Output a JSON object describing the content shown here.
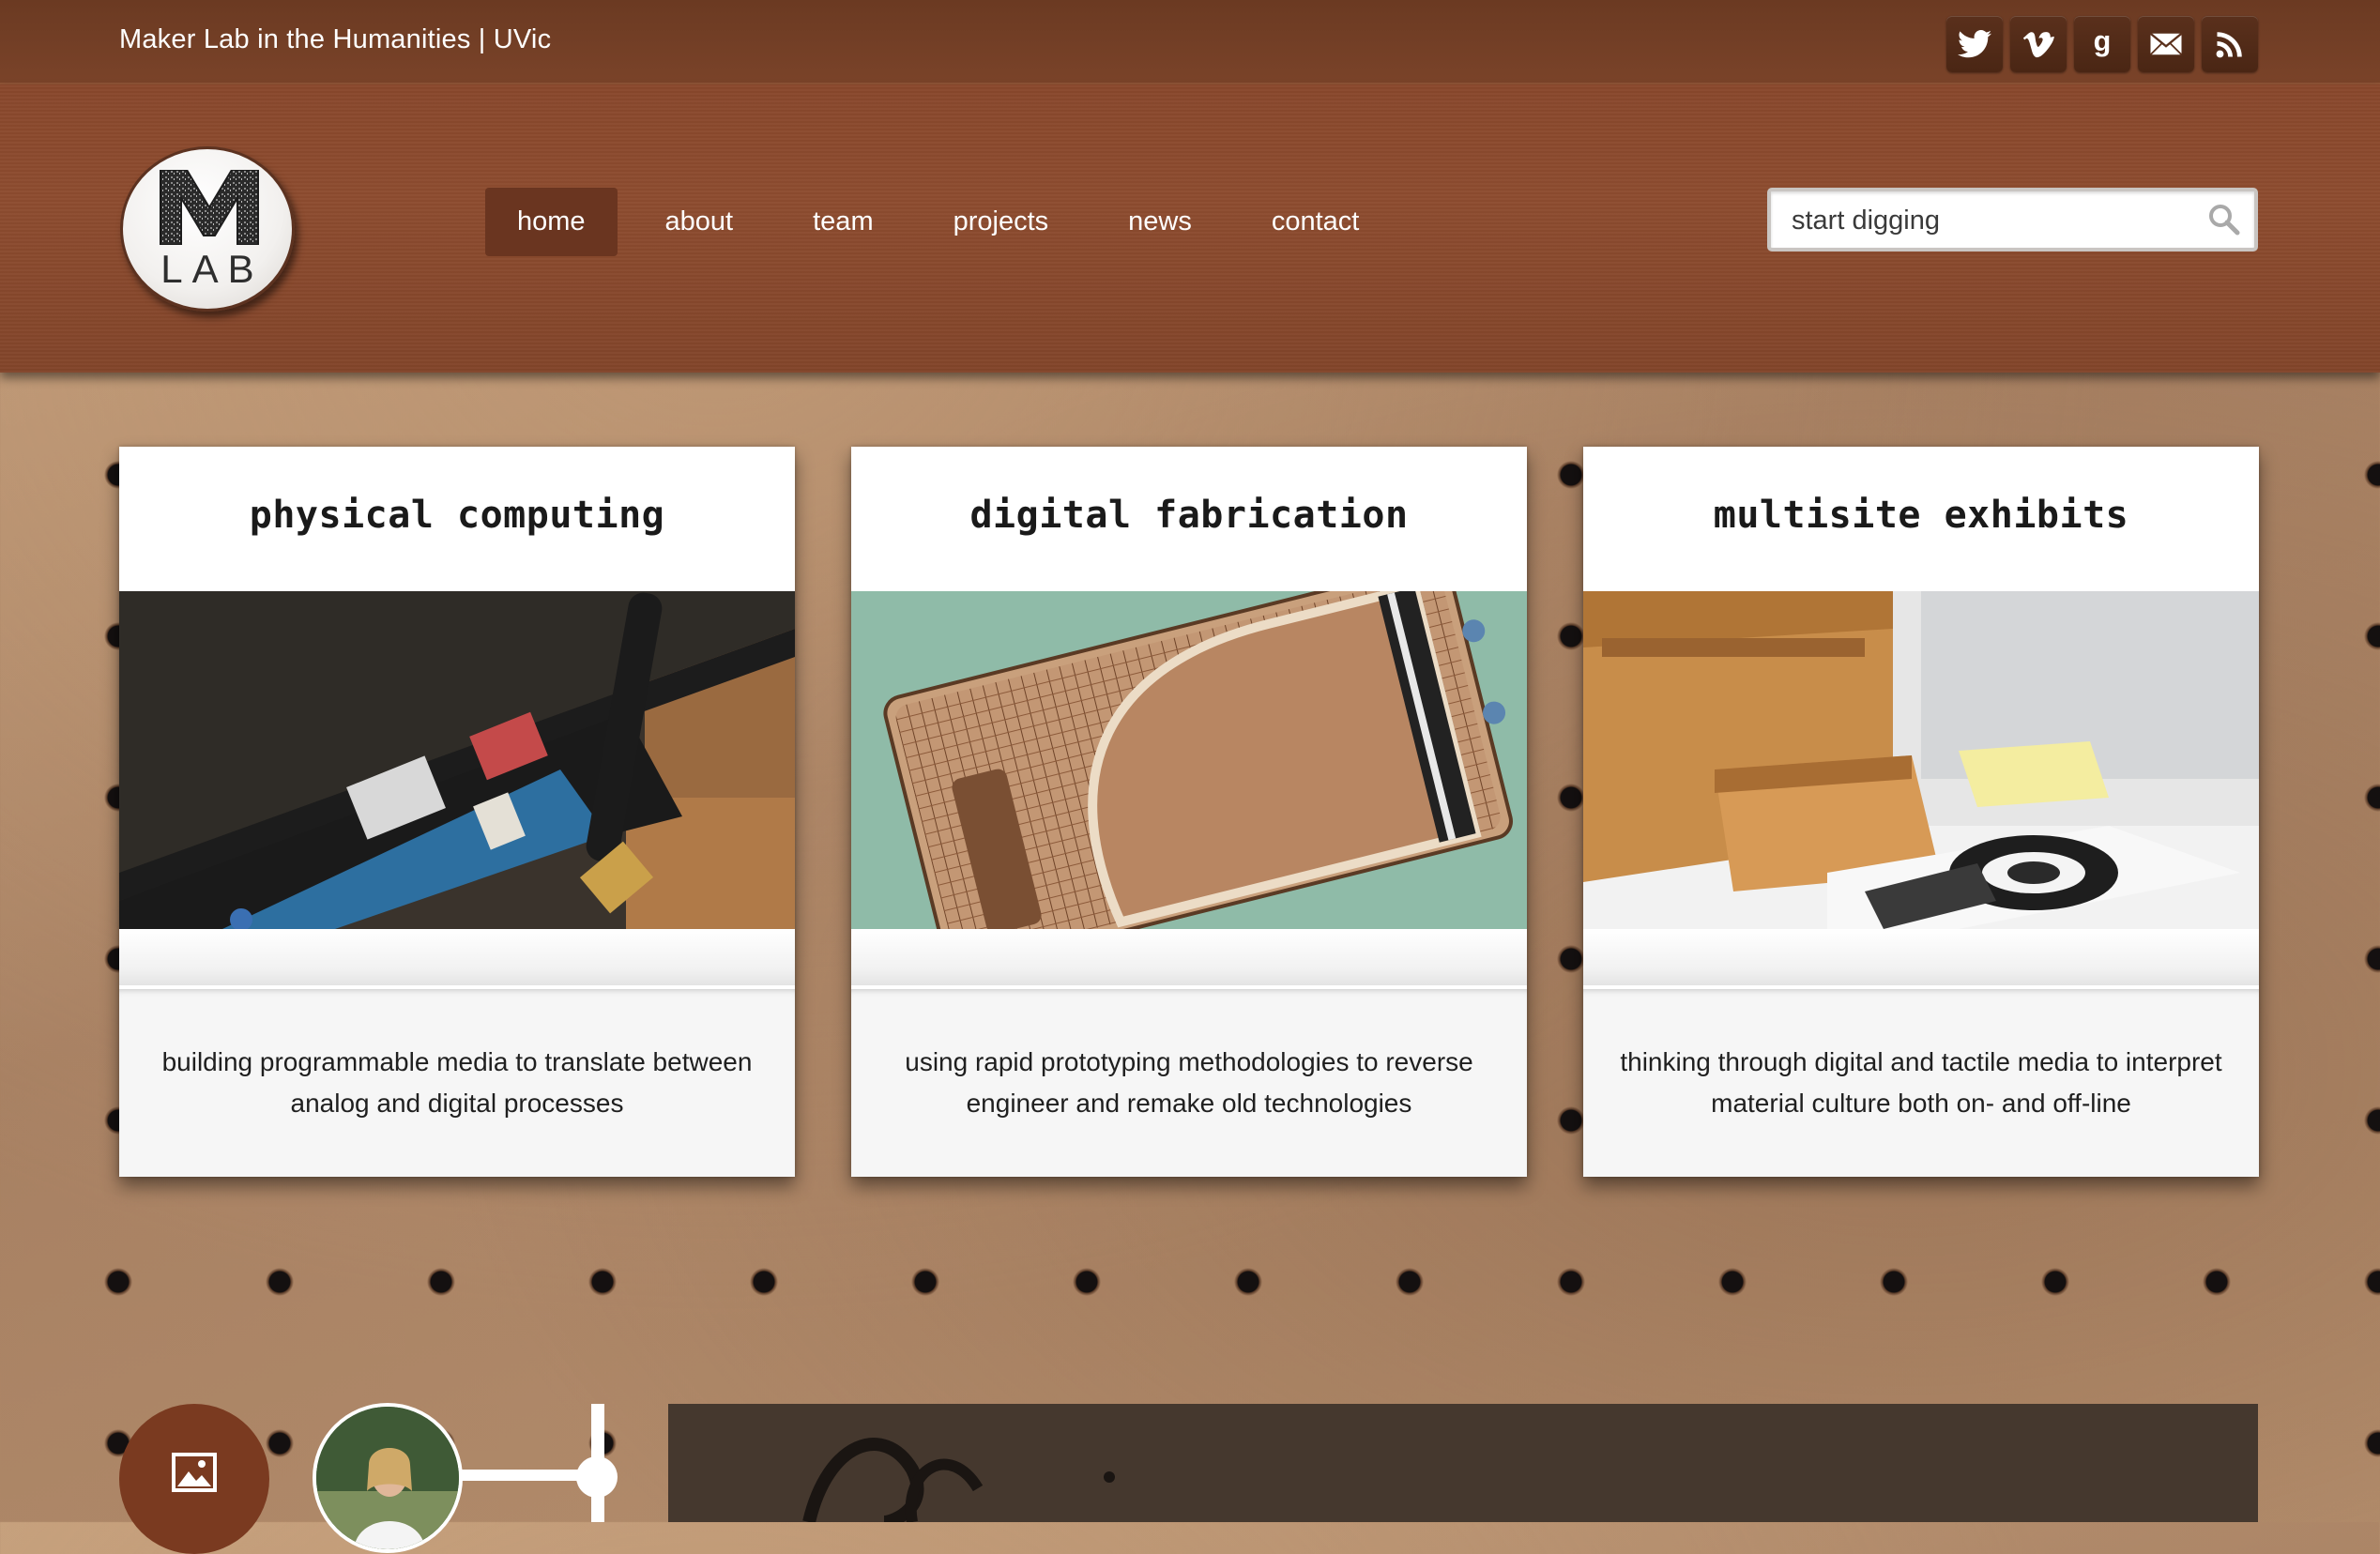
{
  "topbar": {
    "site_name": "Maker Lab in the Humanities | UVic",
    "social_icons": [
      "twitter-icon",
      "vimeo-icon",
      "goodreads-icon",
      "email-icon",
      "rss-icon"
    ]
  },
  "header": {
    "logo_text": "LAB",
    "nav": [
      {
        "label": "home",
        "active": true
      },
      {
        "label": "about",
        "active": false
      },
      {
        "label": "team",
        "active": false
      },
      {
        "label": "projects",
        "active": false
      },
      {
        "label": "news",
        "active": false
      },
      {
        "label": "contact",
        "active": false
      }
    ],
    "search": {
      "placeholder": "start digging"
    }
  },
  "cards": [
    {
      "title": "physical computing",
      "description": "building programmable media to translate between analog and digital processes"
    },
    {
      "title": "digital fabrication",
      "description": "using rapid prototyping methodologies to reverse engineer and remake old technologies"
    },
    {
      "title": "multisite exhibits",
      "description": "thinking through digital and tactile media to interpret material culture both on- and off-line"
    }
  ],
  "colors": {
    "header": "#8a4a2d",
    "topbar": "#6b3a22",
    "nav_active": "#6a3520",
    "feature_button": "#7a3a20"
  }
}
